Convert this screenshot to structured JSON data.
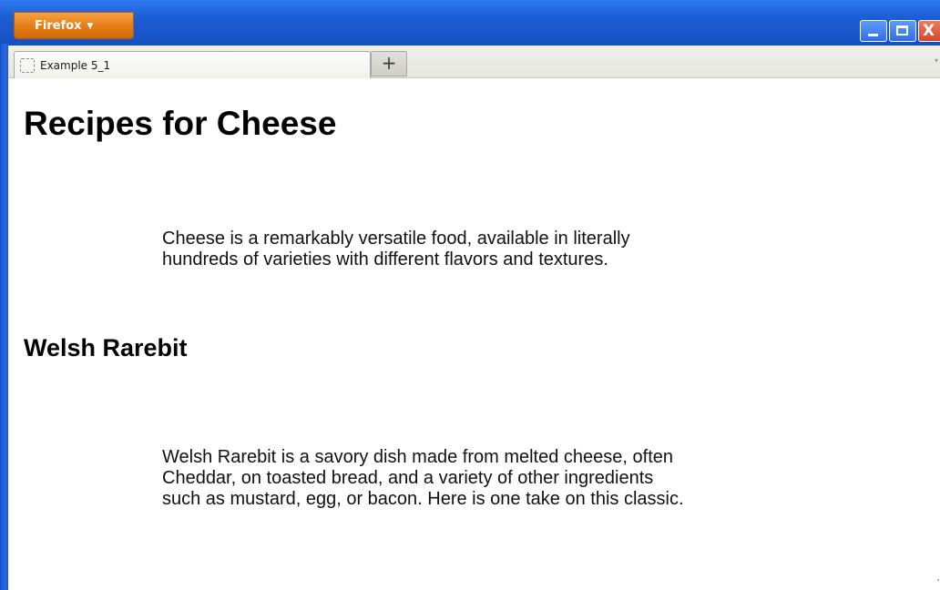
{
  "browser": {
    "app_button_label": "Firefox",
    "app_button_caret": "▼",
    "window_controls": {
      "minimize_icon": "minimize-icon",
      "maximize_icon": "maximize-icon",
      "close_icon": "close-icon",
      "close_glyph": "X"
    },
    "tabs": [
      {
        "title": "Example 5_1",
        "favicon": "blank-page-icon"
      }
    ],
    "new_tab_label": "+",
    "tab_list_glyph": "▾",
    "colors": {
      "titlebar": "#1c5fd6",
      "app_button": "#e57c14",
      "close_button": "#d8462a"
    }
  },
  "page": {
    "title": "Recipes for Cheese",
    "intro": {
      "lines": [
        "Cheese is a remarkably versatile food, available in literally",
        "hundreds of varieties with different flavors and textures."
      ]
    },
    "section": {
      "title": "Welsh Rarebit",
      "lines": [
        "Welsh Rarebit is a savory dish made from melted cheese, often",
        "Cheddar, on toasted bread, and a variety of other ingredients",
        "such as mustard, egg, or bacon. Here is one take on this classic."
      ]
    }
  }
}
